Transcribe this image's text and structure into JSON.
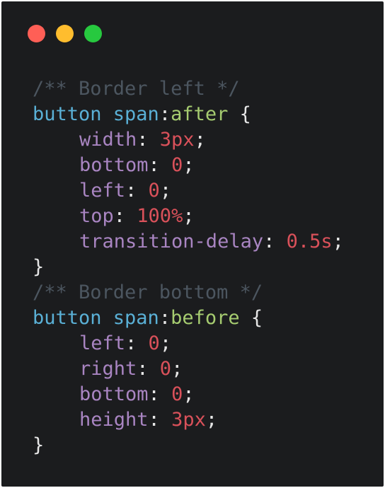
{
  "window_controls": {
    "close_color": "#ff5f56",
    "minimize_color": "#ffbd2e",
    "zoom_color": "#27c93f"
  },
  "colors": {
    "background": "#1b1c1e",
    "comment": "#4c5660",
    "selector": "#5ab0d6",
    "pseudo": "#a6cc70",
    "property": "#a985c2",
    "value": "#d9515a",
    "punctuation": "#e6e6e6"
  },
  "code": {
    "comment1": "/** Border left */",
    "rule1": {
      "selector": "button span",
      "colon": ":",
      "pseudo": "after",
      "open": " {",
      "decls": [
        {
          "prop": "width",
          "value": "3px"
        },
        {
          "prop": "bottom",
          "value": "0"
        },
        {
          "prop": "left",
          "value": "0"
        },
        {
          "prop": "top",
          "value": "100%"
        },
        {
          "prop": "transition-delay",
          "value": "0.5s"
        }
      ],
      "close": "}"
    },
    "comment2": "/** Border bottom */",
    "rule2": {
      "selector": "button span",
      "colon": ":",
      "pseudo": "before",
      "open": " {",
      "decls": [
        {
          "prop": "left",
          "value": "0"
        },
        {
          "prop": "right",
          "value": "0"
        },
        {
          "prop": "bottom",
          "value": "0"
        },
        {
          "prop": "height",
          "value": "3px"
        }
      ],
      "close": "}"
    },
    "sep": ": ",
    "semi": ";"
  }
}
